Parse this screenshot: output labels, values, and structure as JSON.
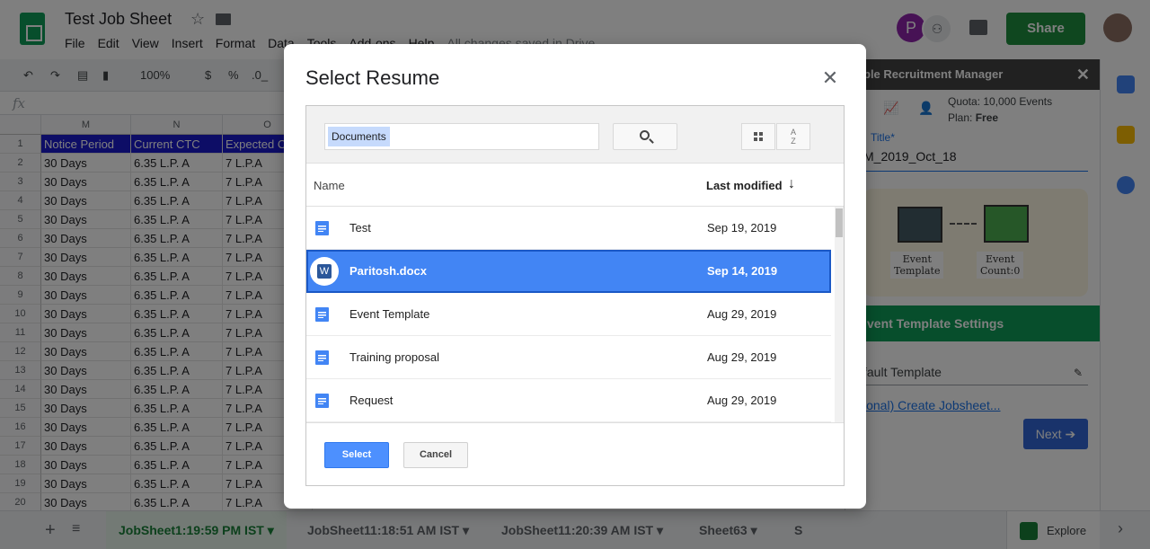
{
  "app": {
    "doc_title": "Test Job Sheet",
    "menu": [
      "File",
      "Edit",
      "View",
      "Insert",
      "Format",
      "Data",
      "Tools",
      "Add-ons",
      "Help"
    ],
    "saved_status": "All changes saved in Drive",
    "avatar_letter": "P",
    "share_label": "Share",
    "toolbar": {
      "zoom": "100%",
      "currency": "$",
      "percent": "%",
      "decimal": ".0_",
      "decimal2": ".0"
    },
    "fx": "fx",
    "columns": [
      "M",
      "N",
      "O"
    ],
    "row_numbers": [
      "1",
      "2",
      "3",
      "4",
      "5",
      "6",
      "7",
      "8",
      "9",
      "10",
      "11",
      "12",
      "13",
      "14",
      "15",
      "16",
      "17",
      "18",
      "19",
      "20"
    ],
    "header_cells": [
      "Notice Period",
      "Current CTC",
      "Expected CTC"
    ],
    "data_row": [
      "30 Days",
      "6.35 L.P. A",
      "7 L.P.A"
    ],
    "sheet_tabs": [
      "JobSheet1:19:59 PM IST",
      "JobSheet11:18:51 AM IST",
      "JobSheet11:20:39 AM IST",
      "Sheet63",
      "S"
    ],
    "explore_label": "Explore"
  },
  "addon": {
    "header": "ble Recruitment Manager",
    "quota_line1": "Quota: 10,000 Events",
    "quota_line2_prefix": "Plan: ",
    "plan": "Free",
    "title_label": "Title*",
    "title_value": "M_2019_Oct_18",
    "event_template_label": "Event\nTemplate",
    "event_count_label": "Event\nCount:0",
    "settings_bar": "vent Template Settings",
    "default_template": "fault Template",
    "create_link": "ional) Create Jobsheet...",
    "next_label": "Next"
  },
  "dialog": {
    "title": "Select Resume",
    "search_chip": "Documents",
    "col_name": "Name",
    "col_modified": "Last modified",
    "files": [
      {
        "name": "Test",
        "date": "Sep 19, 2019",
        "type": "doc"
      },
      {
        "name": "Paritosh.docx",
        "date": "Sep 14, 2019",
        "type": "word"
      },
      {
        "name": "Event Template",
        "date": "Aug 29, 2019",
        "type": "doc"
      },
      {
        "name": "Training proposal",
        "date": "Aug 29, 2019",
        "type": "doc"
      },
      {
        "name": "Request",
        "date": "Aug 29, 2019",
        "type": "doc"
      }
    ],
    "selected_index": 1,
    "select_label": "Select",
    "cancel_label": "Cancel"
  },
  "colors": {
    "header_fill": "#1a1acc",
    "share_green": "#1e8e3e",
    "selection_blue": "#4285f4",
    "select_button": "#4d90fe"
  }
}
